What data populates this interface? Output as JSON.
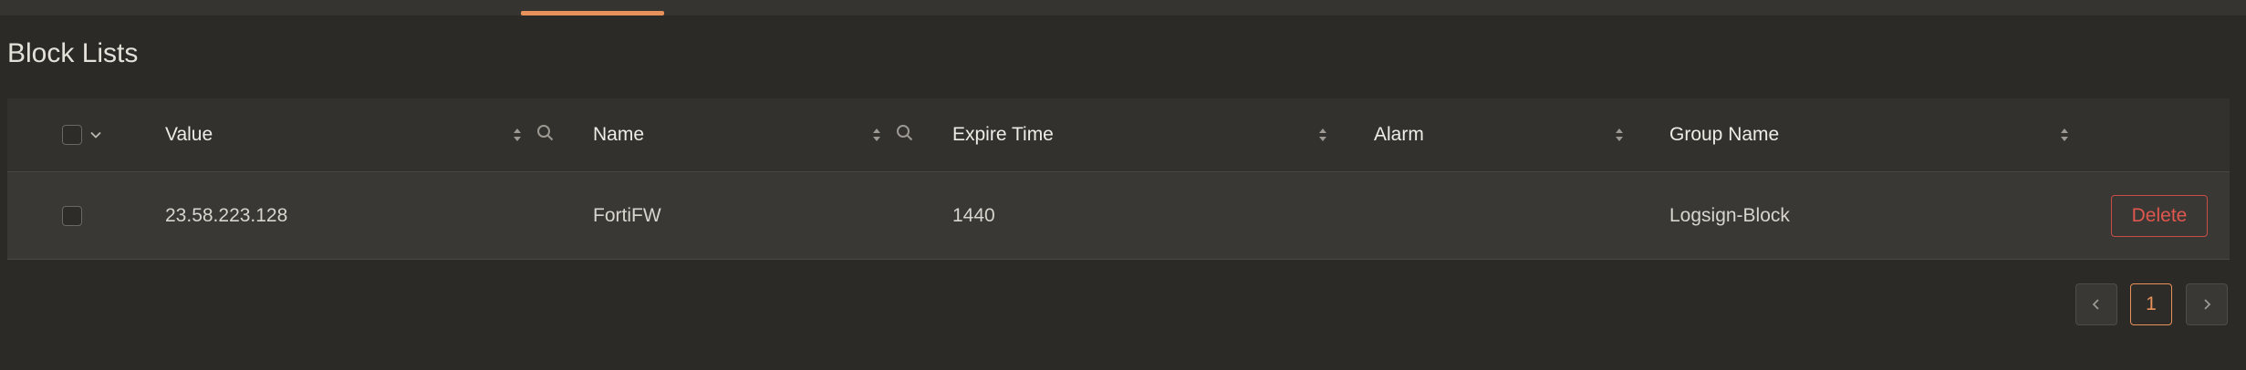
{
  "page": {
    "title": "Block Lists"
  },
  "table": {
    "columns": [
      {
        "label": "Value",
        "sortable": true,
        "searchable": true
      },
      {
        "label": "Name",
        "sortable": true,
        "searchable": true
      },
      {
        "label": "Expire Time",
        "sortable": true,
        "searchable": false
      },
      {
        "label": "Alarm",
        "sortable": true,
        "searchable": false
      },
      {
        "label": "Group Name",
        "sortable": true,
        "searchable": false
      }
    ],
    "rows": [
      {
        "value": "23.58.223.128",
        "name": "FortiFW",
        "expire_time": "1440",
        "alarm": "",
        "group_name": "Logsign-Block",
        "action_label": "Delete"
      }
    ]
  },
  "pagination": {
    "current_page": "1",
    "prev_icon": "chevron-left-icon",
    "next_icon": "chevron-right-icon"
  },
  "colors": {
    "accent": "#e8915a",
    "danger": "#e0574f",
    "background": "#2c2a26",
    "header_background": "#33312d",
    "row_background": "#3a3834"
  }
}
